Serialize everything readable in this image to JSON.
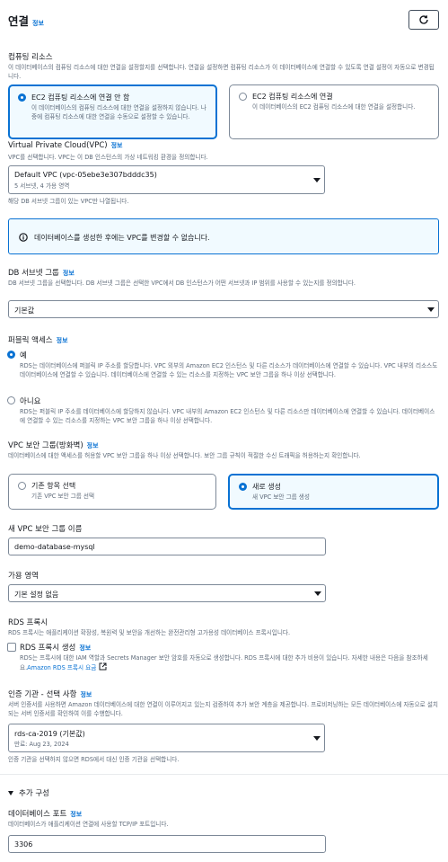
{
  "header": {
    "title": "연결",
    "info": "정보"
  },
  "compute": {
    "label": "컴퓨팅 리소스",
    "desc": "이 데이터베이스의 컴퓨팅 리소스에 대한 연결을 설정할지를 선택합니다. 연결을 설정하면 컴퓨팅 리소스가 이 데이터베이스에 연결할 수 있도록 연결 설정이 자동으로 변경됩니다.",
    "options": [
      {
        "title": "EC2 컴퓨팅 리소스에 연결 안 함",
        "desc": "이 데이터베이스의 컴퓨팅 리소스에 대한 연결을 설정하지 않습니다. 나중에 컴퓨팅 리소스에 대한 연결을 수동으로 설정할 수 있습니다.",
        "selected": true
      },
      {
        "title": "EC2 컴퓨팅 리소스에 연결",
        "desc": "이 데이터베이스의 EC2 컴퓨팅 리소스에 대한 연결을 설정합니다.",
        "selected": false
      }
    ]
  },
  "vpc": {
    "label": "Virtual Private Cloud(VPC)",
    "info": "정보",
    "desc": "VPC를 선택합니다. VPC는 이 DB 인스턴스의 가상 네트워킹 환경을 정의합니다.",
    "value": "Default VPC (vpc-05ebe3e307bdddc35)",
    "sub": "5 서브넷, 4 가용 영역",
    "hint": "해당 DB 서브넷 그룹이 있는 VPC만 나열됩니다.",
    "alert": "데이터베이스를 생성한 후에는 VPC를 변경할 수 없습니다."
  },
  "subnet": {
    "label": "DB 서브넷 그룹",
    "info": "정보",
    "desc": "DB 서브넷 그룹을 선택합니다. DB 서브넷 그룹은 선택한 VPC에서 DB 인스턴스가 어떤 서브넷과 IP 범위를 사용할 수 있는지를 정의합니다.",
    "value": "기본값"
  },
  "public": {
    "label": "퍼블릭 액세스",
    "info": "정보",
    "yes": {
      "title": "예",
      "desc": "RDS는 데이터베이스에 퍼블릭 IP 주소를 할당합니다. VPC 외부의 Amazon EC2 인스턴스 및 다른 리소스가 데이터베이스에 연결할 수 있습니다. VPC 내부의 리소스도 데이터베이스에 연결할 수 있습니다. 데이터베이스에 연결할 수 있는 리소스를 지정하는 VPC 보안 그룹을 하나 이상 선택합니다.",
      "selected": true
    },
    "no": {
      "title": "아니요",
      "desc": "RDS는 퍼블릭 IP 주소를 데이터베이스에 할당하지 않습니다. VPC 내부의 Amazon EC2 인스턴스 및 다른 리소스만 데이터베이스에 연결할 수 있습니다. 데이터베이스에 연결할 수 있는 리소스를 지정하는 VPC 보안 그룹을 하나 이상 선택합니다.",
      "selected": false
    }
  },
  "sg": {
    "label": "VPC 보안 그룹(방화벽)",
    "info": "정보",
    "desc": "데이터베이스에 대한 액세스를 허용할 VPC 보안 그룹을 하나 이상 선택합니다. 보안 그룹 규칙이 적절한 수신 트래픽을 허용하는지 확인합니다.",
    "options": [
      {
        "title": "기존 항목 선택",
        "desc": "기존 VPC 보안 그룹 선택",
        "selected": false
      },
      {
        "title": "새로 생성",
        "desc": "새 VPC 보안 그룹 생성",
        "selected": true
      }
    ]
  },
  "new_sg": {
    "label": "새 VPC 보안 그룹 이름",
    "value": "demo-database-mysql"
  },
  "az": {
    "label": "가용 영역",
    "value": "기본 설정 없음"
  },
  "proxy": {
    "label": "RDS 프록시",
    "desc": "RDS 프록시는 애플리케이션 확장성, 복원력 및 보안을 개선하는 완전관리형 고가용성 데이터베이스 프록시입니다.",
    "cb_label": "RDS 프록시 생성",
    "info": "정보",
    "cb_desc": "RDS는 프록시에 대한 IAM 역할과 Secrets Manager 보안 암호를 자동으로 생성합니다. RDS 프록시에 대한 추가 비용이 있습니다. 자세한 내용은 다음을 참조하세요.",
    "link": "Amazon RDS 프록시 요금"
  },
  "ca": {
    "label": "인증 기관 - 선택 사항",
    "info": "정보",
    "desc": "서버 인증서를 사용하면 Amazon 데이터베이스에 대한 연결이 이루어지고 있는지 검증하여 추가 보안 계층을 제공합니다. 프로비저닝하는 모든 데이터베이스에 자동으로 설치되는 서버 인증서를 확인하여 이를 수행합니다.",
    "value": "rds-ca-2019 (기본값)",
    "sub": "만료: Aug 23, 2024",
    "hint": "인증 기관을 선택하지 않으면 RDS에서 대신 인증 기관을 선택합니다."
  },
  "extra": {
    "title": "추가 구성",
    "port_label": "데이터베이스 포트",
    "info": "정보",
    "port_desc": "데이터베이스가 애플리케이션 연결에 사용할 TCP/IP 포트입니다.",
    "port_value": "3306"
  },
  "colors": {
    "accent": "#0972d3",
    "text": "#16191f",
    "muted": "#5f6b7a",
    "border": "#7d8998"
  }
}
